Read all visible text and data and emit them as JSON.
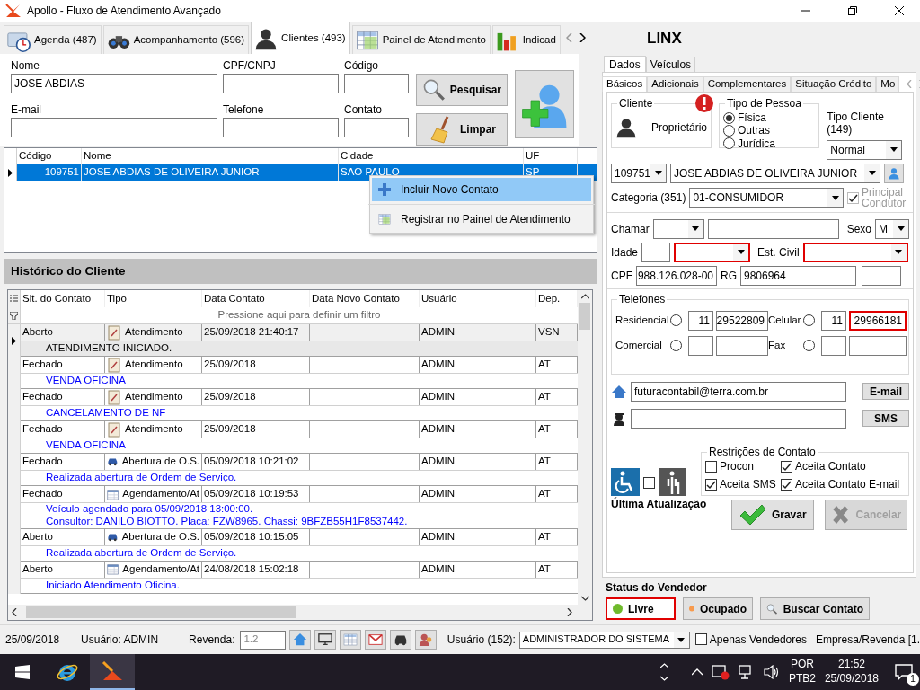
{
  "window": {
    "title": "Apollo - Fluxo de Atendimento Avançado"
  },
  "main_tabs": [
    {
      "label": "Agenda (487)",
      "selected": false
    },
    {
      "label": "Acompanhamento (596)",
      "selected": false
    },
    {
      "label": "Clientes (493)",
      "selected": true
    },
    {
      "label": "Painel de Atendimento",
      "selected": false
    },
    {
      "label": "Indicad",
      "selected": false
    }
  ],
  "search": {
    "fields": [
      {
        "label": "Nome",
        "value": "JOSE ABDIAS"
      },
      {
        "label": "CPF/CNPJ"
      },
      {
        "label": "Código"
      },
      {
        "label": "E-mail"
      },
      {
        "label": "Telefone"
      },
      {
        "label": "Contato"
      }
    ],
    "buttons": [
      "Pesquisar",
      "Limpar"
    ]
  },
  "clients": {
    "columns": [
      "Código",
      "Nome",
      "Cidade",
      "UF"
    ],
    "rows": [
      {
        "cells": [
          "109751",
          "JOSE ABDIAS DE OLIVEIRA JUNIOR",
          "SAO PAULO",
          "SP"
        ],
        "selected": true
      }
    ]
  },
  "context_menu": [
    {
      "label": "Incluir Novo Contato",
      "selected": true
    },
    {
      "label": "Registrar no Painel de Atendimento",
      "selected": false
    }
  ],
  "history": {
    "title": "Histórico do Cliente",
    "columns": [
      "Sit. do Contato",
      "Tipo",
      "Data Contato",
      "Data Novo Contato",
      "Usuário",
      "Dep."
    ],
    "filter_hint": "Pressione aqui para definir um filtro",
    "rows": [
      {
        "status": "Aberto",
        "kind": "note",
        "type": "Atendimento",
        "date": "25/09/2018 21:40:17",
        "user": "ADMIN",
        "dep": "VSN",
        "note": [
          "ATENDIMENTO INICIADO."
        ],
        "selected": true
      },
      {
        "status": "Fechado",
        "kind": "note",
        "type": "Atendimento",
        "date": "25/09/2018",
        "user": "ADMIN",
        "dep": "AT",
        "note": [
          "VENDA OFICINA"
        ],
        "selected": false
      },
      {
        "status": "Fechado",
        "kind": "note",
        "type": "Atendimento",
        "date": "25/09/2018",
        "user": "ADMIN",
        "dep": "AT",
        "note": [
          "CANCELAMENTO DE NF"
        ],
        "selected": false
      },
      {
        "status": "Fechado",
        "kind": "note",
        "type": "Atendimento",
        "date": "25/09/2018",
        "user": "ADMIN",
        "dep": "AT",
        "note": [
          "VENDA OFICINA"
        ],
        "selected": false
      },
      {
        "status": "Fechado",
        "kind": "car",
        "type": "Abertura de O.S.",
        "date": "05/09/2018 10:21:02",
        "user": "ADMIN",
        "dep": "AT",
        "note": [
          "Realizada abertura de Ordem de Serviço."
        ],
        "selected": false
      },
      {
        "status": "Fechado",
        "kind": "calendar",
        "type": "Agendamento/At",
        "date": "05/09/2018 10:19:53",
        "user": "ADMIN",
        "dep": "AT",
        "note": [
          "Veículo agendado para 05/09/2018 13:00:00.",
          "Consultor: DANILO BIOTTO. Placa: FZW8965. Chassi: 9BFZB55H1F8537442."
        ],
        "selected": false
      },
      {
        "status": "Aberto",
        "kind": "car",
        "type": "Abertura de O.S.",
        "date": "05/09/2018 10:15:05",
        "user": "ADMIN",
        "dep": "AT",
        "note": [
          "Realizada abertura de Ordem de Serviço."
        ],
        "selected": false
      },
      {
        "status": "Aberto",
        "kind": "calendar",
        "type": "Agendamento/At",
        "date": "24/08/2018 15:02:18",
        "user": "ADMIN",
        "dep": "AT",
        "note": [
          "Iniciado Atendimento Oficina."
        ],
        "selected": false
      }
    ]
  },
  "right": {
    "title": "LINX",
    "tabs": [
      {
        "label": "Dados",
        "selected": true
      },
      {
        "label": "Veículos",
        "selected": false
      }
    ],
    "subtabs": [
      {
        "label": "Básicos",
        "selected": true
      },
      {
        "label": "Adicionais",
        "selected": false
      },
      {
        "label": "Complementares",
        "selected": false
      },
      {
        "label": "Situação Crédito",
        "selected": false
      },
      {
        "label": "Mo",
        "selected": false
      }
    ],
    "cliente": {
      "legend": "Cliente",
      "label": "Proprietário"
    },
    "tipo_pessoa": {
      "legend": "Tipo de Pessoa",
      "options": [
        {
          "label": "Física",
          "selected": true
        },
        {
          "label": "Outras",
          "selected": false
        },
        {
          "label": "Jurídica",
          "selected": false
        }
      ]
    },
    "tipo_cliente": {
      "label": "Tipo Cliente (149)",
      "value": "Normal"
    },
    "client_code": "109751",
    "client_name": "JOSE ABDIAS DE OLIVEIRA JUNIOR",
    "categoria": {
      "label": "Categoria (351)",
      "value": "01-CONSUMIDOR"
    },
    "principal_condutor": {
      "label": "Principal Condutor",
      "checked": true,
      "disabled": true
    },
    "chamar": {
      "label": "Chamar"
    },
    "sexo": {
      "label": "Sexo",
      "value": "M"
    },
    "idade": {
      "label": "Idade",
      "highlighted": true
    },
    "est_civil": {
      "label": "Est. Civil",
      "highlighted": true
    },
    "cpf": {
      "label": "CPF",
      "value": "988.126.028-00"
    },
    "rg": {
      "label": "RG",
      "value": "9806964"
    },
    "telefones": {
      "legend": "Telefones",
      "items": [
        {
          "label": "Residencial",
          "selected": false,
          "ddd": "11",
          "number": "29522809",
          "highlighted": false
        },
        {
          "label": "Celular",
          "selected": false,
          "ddd": "11",
          "number": "29966181",
          "highlighted": true
        },
        {
          "label": "Comercial",
          "selected": false,
          "highlighted": false
        },
        {
          "label": "Fax",
          "selected": false,
          "highlighted": false
        }
      ]
    },
    "email": {
      "value": "futuracontabil@terra.com.br",
      "button": "E-mail"
    },
    "sms": {
      "button": "SMS"
    },
    "restricoes": {
      "legend": "Restrições de Contato",
      "items": [
        {
          "label": "Procon",
          "checked": false
        },
        {
          "label": "Aceita Contato",
          "checked": true
        },
        {
          "label": "Aceita SMS",
          "checked": true
        },
        {
          "label": "Aceita Contato E-mail",
          "checked": true
        }
      ]
    },
    "deficiente": {
      "checked": false
    },
    "ultima_atualizacao": "Última Atualização",
    "actions": [
      {
        "label": "Gravar",
        "disabled": false
      },
      {
        "label": "Cancelar",
        "disabled": true
      }
    ]
  },
  "vendor_status": {
    "title": "Status do Vendedor",
    "items": [
      {
        "label": "Livre",
        "color": "#6fba2c",
        "selected": true
      },
      {
        "label": "Ocupado",
        "color": "#f79a4d",
        "selected": false
      }
    ],
    "search_button": "Buscar Contato"
  },
  "status_bar": {
    "date": "25/09/2018",
    "user": "Usuário: ADMIN",
    "revenda_label": "Revenda:",
    "revenda_value": "1.2",
    "user_select_label": "Usuário (152):",
    "user_select_value": "ADMINISTRADOR DO SISTEMA",
    "apenas": {
      "label": "Apenas Vendedores",
      "checked": false
    },
    "empresa": "Empresa/Revenda [1."
  },
  "taskbar": {
    "lang": "POR",
    "layout": "PTB2",
    "time": "21:52",
    "date": "25/09/2018",
    "notifications": "1"
  }
}
